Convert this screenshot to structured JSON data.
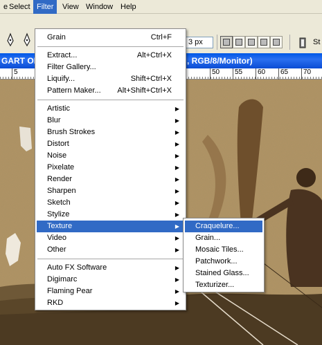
{
  "menubar": {
    "items": [
      {
        "label": "File",
        "partial": "e"
      },
      {
        "label": "Select"
      },
      {
        "label": "Filter",
        "active": true
      },
      {
        "label": "View"
      },
      {
        "label": "Window"
      },
      {
        "label": "Help"
      }
    ]
  },
  "toolbar": {
    "brush_size": "3 px",
    "right_label": "St"
  },
  "document": {
    "title_left": "GART OL",
    "title_right": ", RGB/8/Monitor)"
  },
  "ruler": {
    "ticks": [
      "5",
      "50",
      "55",
      "60",
      "65",
      "70"
    ]
  },
  "filter_menu": {
    "items": [
      {
        "label": "Grain",
        "shortcut": "Ctrl+F"
      },
      {
        "label": "Extract...",
        "shortcut": "Alt+Ctrl+X"
      },
      {
        "label": "Filter Gallery..."
      },
      {
        "label": "Liquify...",
        "shortcut": "Shift+Ctrl+X"
      },
      {
        "label": "Pattern Maker...",
        "shortcut": "Alt+Shift+Ctrl+X"
      },
      {
        "label": "Artistic",
        "submenu": true
      },
      {
        "label": "Blur",
        "submenu": true
      },
      {
        "label": "Brush Strokes",
        "submenu": true
      },
      {
        "label": "Distort",
        "submenu": true
      },
      {
        "label": "Noise",
        "submenu": true
      },
      {
        "label": "Pixelate",
        "submenu": true
      },
      {
        "label": "Render",
        "submenu": true
      },
      {
        "label": "Sharpen",
        "submenu": true
      },
      {
        "label": "Sketch",
        "submenu": true
      },
      {
        "label": "Stylize",
        "submenu": true
      },
      {
        "label": "Texture",
        "submenu": true,
        "highlighted": true
      },
      {
        "label": "Video",
        "submenu": true
      },
      {
        "label": "Other",
        "submenu": true
      },
      {
        "label": "Auto FX Software",
        "submenu": true
      },
      {
        "label": "Digimarc",
        "submenu": true
      },
      {
        "label": "Flaming Pear",
        "submenu": true
      },
      {
        "label": "RKD",
        "submenu": true
      }
    ]
  },
  "texture_menu": {
    "items": [
      {
        "label": "Craquelure...",
        "highlighted": true
      },
      {
        "label": "Grain..."
      },
      {
        "label": "Mosaic Tiles..."
      },
      {
        "label": "Patchwork..."
      },
      {
        "label": "Stained Glass..."
      },
      {
        "label": "Texturizer..."
      }
    ]
  },
  "colors": {
    "highlight": "#316ac5",
    "title_bar": "#0a4cd4",
    "sepia": "#a88c5e"
  }
}
